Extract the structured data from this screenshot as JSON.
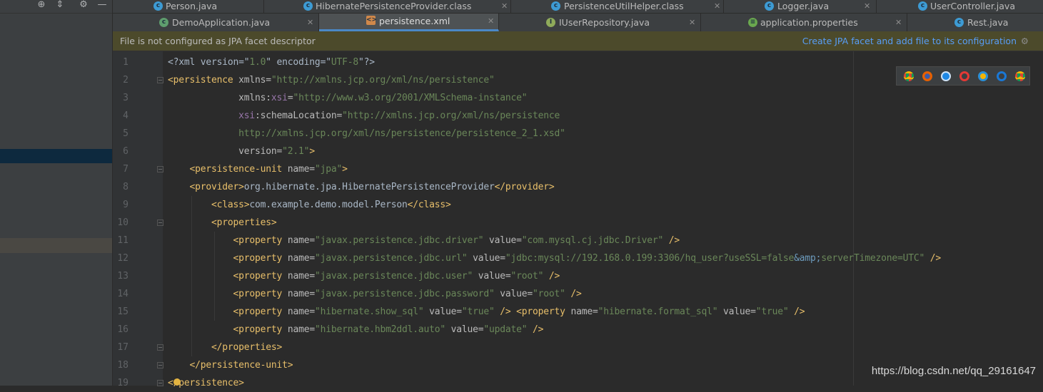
{
  "top_tabs": [
    {
      "label": "Person.java",
      "icon": "java-class-icon"
    },
    {
      "label": "HibernatePersistenceProvider.class",
      "icon": "class-file-icon"
    },
    {
      "label": "PersistenceUtilHelper.class",
      "icon": "class-file-icon"
    },
    {
      "label": "Logger.java",
      "icon": "java-class-icon"
    },
    {
      "label": "UserController.java",
      "icon": "java-class-icon"
    }
  ],
  "second_tabs": [
    {
      "label": "DemoApplication.java",
      "icon": "spring-boot-class-icon"
    },
    {
      "label": "persistence.xml",
      "icon": "xml-file-icon",
      "active": true
    },
    {
      "label": "IUserRepository.java",
      "icon": "interface-icon"
    },
    {
      "label": "application.properties",
      "icon": "properties-file-icon"
    },
    {
      "label": "Rest.java",
      "icon": "java-class-icon"
    }
  ],
  "banner": {
    "message": "File is not configured as JPA facet descriptor",
    "action": "Create JPA facet and add file to its configuration"
  },
  "code": {
    "line_numbers": [
      "1",
      "2",
      "3",
      "4",
      "5",
      "6",
      "7",
      "8",
      "9",
      "10",
      "11",
      "12",
      "13",
      "14",
      "15",
      "16",
      "17",
      "18",
      "19"
    ],
    "lines": [
      [
        [
          "p",
          "<?xml version=\""
        ],
        [
          "v",
          "1.0"
        ],
        [
          "p",
          "\" encoding=\""
        ],
        [
          "v",
          "UTF-8"
        ],
        [
          "p",
          "\"?>"
        ]
      ],
      [
        [
          "t",
          "<persistence "
        ],
        [
          "a",
          "xmlns="
        ],
        [
          "v",
          "\"http://xmlns.jcp.org/xml/ns/persistence\""
        ]
      ],
      [
        [
          "p",
          "             "
        ],
        [
          "a",
          "xmlns:"
        ],
        [
          "n",
          "xsi"
        ],
        [
          "a",
          "="
        ],
        [
          "v",
          "\"http://www.w3.org/2001/XMLSchema-instance\""
        ]
      ],
      [
        [
          "p",
          "             "
        ],
        [
          "n",
          "xsi"
        ],
        [
          "a",
          ":schemaLocation="
        ],
        [
          "v",
          "\"http://xmlns.jcp.org/xml/ns/persistence"
        ]
      ],
      [
        [
          "p",
          "             "
        ],
        [
          "v",
          "http://xmlns.jcp.org/xml/ns/persistence/persistence_2_1.xsd\""
        ]
      ],
      [
        [
          "p",
          "             "
        ],
        [
          "a",
          "version="
        ],
        [
          "v",
          "\"2.1\""
        ],
        [
          "t",
          ">"
        ]
      ],
      [
        [
          "p",
          "    "
        ],
        [
          "t",
          "<persistence-unit "
        ],
        [
          "a",
          "name="
        ],
        [
          "v",
          "\"jpa\""
        ],
        [
          "t",
          ">"
        ]
      ],
      [
        [
          "p",
          "    "
        ],
        [
          "t",
          "<provider>"
        ],
        [
          "p",
          "org.hibernate.jpa.HibernatePersistenceProvider"
        ],
        [
          "t",
          "</provider>"
        ]
      ],
      [
        [
          "p",
          "        "
        ],
        [
          "t",
          "<class>"
        ],
        [
          "p",
          "com.example.demo.model.Person"
        ],
        [
          "t",
          "</class>"
        ]
      ],
      [
        [
          "p",
          "        "
        ],
        [
          "t",
          "<properties>"
        ]
      ],
      [
        [
          "p",
          "            "
        ],
        [
          "t",
          "<property "
        ],
        [
          "a",
          "name="
        ],
        [
          "v",
          "\"javax.persistence.jdbc.driver\""
        ],
        [
          "a",
          " value="
        ],
        [
          "v",
          "\"com.mysql.cj.jdbc.Driver\""
        ],
        [
          "t",
          " />"
        ]
      ],
      [
        [
          "p",
          "            "
        ],
        [
          "t",
          "<property "
        ],
        [
          "a",
          "name="
        ],
        [
          "v",
          "\"javax.persistence.jdbc.url\""
        ],
        [
          "a",
          " value="
        ],
        [
          "v",
          "\"jdbc:mysql://192.168.0.199:3306/hq_user?useSSL=false"
        ],
        [
          "e",
          "&amp;"
        ],
        [
          "v",
          "serverTimezone=UTC\""
        ],
        [
          "t",
          " />"
        ]
      ],
      [
        [
          "p",
          "            "
        ],
        [
          "t",
          "<property "
        ],
        [
          "a",
          "name="
        ],
        [
          "v",
          "\"javax.persistence.jdbc.user\""
        ],
        [
          "a",
          " value="
        ],
        [
          "v",
          "\"root\""
        ],
        [
          "t",
          " />"
        ]
      ],
      [
        [
          "p",
          "            "
        ],
        [
          "t",
          "<property "
        ],
        [
          "a",
          "name="
        ],
        [
          "v",
          "\"javax.persistence.jdbc.password\""
        ],
        [
          "a",
          " value="
        ],
        [
          "v",
          "\"root\""
        ],
        [
          "t",
          " />"
        ]
      ],
      [
        [
          "p",
          "            "
        ],
        [
          "t",
          "<property "
        ],
        [
          "a",
          "name="
        ],
        [
          "v",
          "\"hibernate.show_sql\""
        ],
        [
          "a",
          " value="
        ],
        [
          "v",
          "\"true\""
        ],
        [
          "t",
          " /> <property "
        ],
        [
          "a",
          "name="
        ],
        [
          "v",
          "\"hibernate.format_sql\""
        ],
        [
          "a",
          " value="
        ],
        [
          "v",
          "\"true\""
        ],
        [
          "t",
          " />"
        ]
      ],
      [
        [
          "p",
          "            "
        ],
        [
          "t",
          "<property "
        ],
        [
          "a",
          "name="
        ],
        [
          "v",
          "\"hibernate.hbm2ddl.auto\""
        ],
        [
          "a",
          " value="
        ],
        [
          "v",
          "\"update\""
        ],
        [
          "t",
          " />"
        ]
      ],
      [
        [
          "p",
          "        "
        ],
        [
          "t",
          "</properties>"
        ]
      ],
      [
        [
          "p",
          "    "
        ],
        [
          "t",
          "</persistence-unit>"
        ]
      ],
      [
        [
          "t",
          "</persistence>"
        ]
      ]
    ]
  },
  "browsers": [
    "chrome-icon",
    "firefox-icon",
    "safari-icon",
    "opera-icon",
    "ie-icon",
    "edge-icon",
    "chrome-icon"
  ],
  "watermark": "https://blog.csdn.net/qq_29161647",
  "colors": {
    "tag": "#e8bf6a",
    "value": "#6a8759",
    "attr": "#bababa",
    "entity": "#6d9cbe",
    "namespace": "#9876aa",
    "link": "#589df6"
  }
}
